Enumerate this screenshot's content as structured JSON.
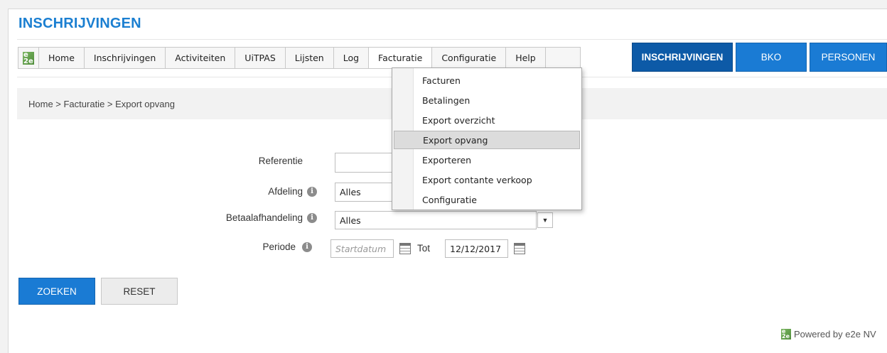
{
  "app": {
    "title": "INSCHRIJVINGEN",
    "logo_text": "e2e"
  },
  "menu": {
    "items": [
      {
        "label": "Home"
      },
      {
        "label": "Inschrijvingen"
      },
      {
        "label": "Activiteiten"
      },
      {
        "label": "UiTPAS"
      },
      {
        "label": "Lijsten"
      },
      {
        "label": "Log"
      },
      {
        "label": "Facturatie"
      },
      {
        "label": "Configuratie"
      },
      {
        "label": "Help"
      }
    ],
    "active": "Facturatie"
  },
  "top_buttons": {
    "inschrijvingen": "INSCHRIJVINGEN",
    "bko": "BKO",
    "personen": "PERSONEN"
  },
  "breadcrumb": {
    "text": "Home > Facturatie > Export opvang"
  },
  "form": {
    "referentie": {
      "label": "Referentie",
      "value": ""
    },
    "afdeling": {
      "label": "Afdeling",
      "value": "Alles"
    },
    "betaalafhandeling": {
      "label": "Betaalafhandeling",
      "value": "Alles"
    },
    "periode": {
      "label": "Periode",
      "start_placeholder": "Startdatum",
      "tot_label": "Tot",
      "end_value": "12/12/2017"
    },
    "info_icon": "i"
  },
  "dropdown": {
    "items": [
      {
        "label": "Facturen"
      },
      {
        "label": "Betalingen"
      },
      {
        "label": "Export overzicht"
      },
      {
        "label": "Export opvang"
      },
      {
        "label": "Exporteren"
      },
      {
        "label": "Export contante verkoop"
      },
      {
        "label": "Configuratie"
      }
    ],
    "hovered": "Export opvang"
  },
  "buttons": {
    "search": "ZOEKEN",
    "reset": "RESET"
  },
  "footer": {
    "powered": "Powered by e2e NV"
  },
  "colors": {
    "accent": "#1a7bd4",
    "accent_dark": "#0d5aa7",
    "title": "#1b7fd1"
  }
}
